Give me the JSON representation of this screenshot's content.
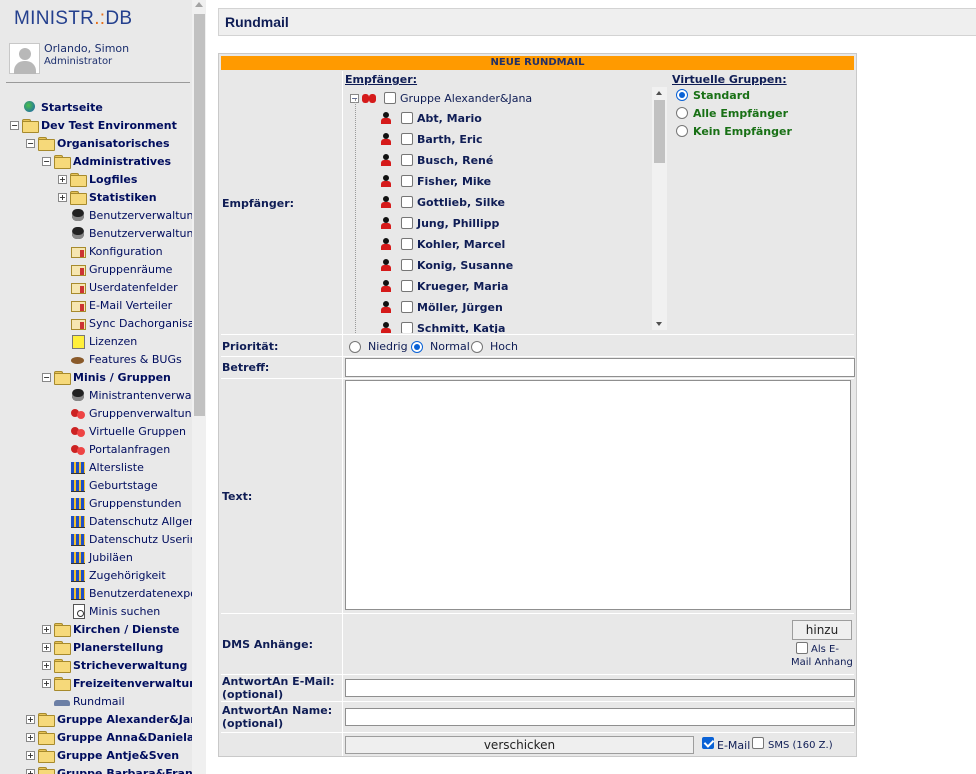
{
  "app": {
    "logo_left": "MINISTR",
    "logo_dot": ".:",
    "logo_right": "DB"
  },
  "user": {
    "name": "Orlando, Simon",
    "role": "Administrator"
  },
  "tree": [
    {
      "label": "Startseite",
      "icon": "globe-icon",
      "level": 0,
      "bold": true,
      "toggle": ""
    },
    {
      "label": "Dev Test Environment",
      "icon": "folder-icon",
      "level": 0,
      "bold": true,
      "toggle": "−"
    },
    {
      "label": "Organisatorisches",
      "icon": "folder-icon",
      "level": 1,
      "bold": true,
      "toggle": "−"
    },
    {
      "label": "Administratives",
      "icon": "folder-icon",
      "level": 2,
      "bold": true,
      "toggle": "−"
    },
    {
      "label": "Logfiles",
      "icon": "folder-icon",
      "level": 3,
      "bold": true,
      "toggle": "+"
    },
    {
      "label": "Statistiken",
      "icon": "folder-icon",
      "level": 3,
      "bold": true,
      "toggle": "+"
    },
    {
      "label": "Benutzerverwaltung",
      "icon": "agent-icon",
      "level": 3,
      "bold": false,
      "toggle": ""
    },
    {
      "label": "Benutzerverwaltung",
      "icon": "agent-icon",
      "level": 3,
      "bold": false,
      "toggle": ""
    },
    {
      "label": "Konfiguration",
      "icon": "config-icon",
      "level": 3,
      "bold": false,
      "toggle": ""
    },
    {
      "label": "Gruppenräume",
      "icon": "config-icon",
      "level": 3,
      "bold": false,
      "toggle": ""
    },
    {
      "label": "Userdatenfelder",
      "icon": "config-icon",
      "level": 3,
      "bold": false,
      "toggle": ""
    },
    {
      "label": "E-Mail Verteiler",
      "icon": "config-icon",
      "level": 3,
      "bold": false,
      "toggle": ""
    },
    {
      "label": "Sync Dachorganisati",
      "icon": "config-icon",
      "level": 3,
      "bold": false,
      "toggle": ""
    },
    {
      "label": "Lizenzen",
      "icon": "license-icon",
      "level": 3,
      "bold": false,
      "toggle": ""
    },
    {
      "label": "Features & BUGs",
      "icon": "bug-icon",
      "level": 3,
      "bold": false,
      "toggle": ""
    },
    {
      "label": "Minis / Gruppen",
      "icon": "folder-icon",
      "level": 2,
      "bold": true,
      "toggle": "−"
    },
    {
      "label": "Ministrantenverwaltu",
      "icon": "agent-icon",
      "level": 3,
      "bold": false,
      "toggle": ""
    },
    {
      "label": "Gruppenverwaltung",
      "icon": "users-icon",
      "level": 3,
      "bold": false,
      "toggle": ""
    },
    {
      "label": "Virtuelle Gruppen",
      "icon": "users-icon",
      "level": 3,
      "bold": false,
      "toggle": ""
    },
    {
      "label": "Portalanfragen",
      "icon": "users-icon",
      "level": 3,
      "bold": false,
      "toggle": ""
    },
    {
      "label": "Altersliste",
      "icon": "chart-icon",
      "level": 3,
      "bold": false,
      "toggle": ""
    },
    {
      "label": "Geburtstage",
      "icon": "chart-icon",
      "level": 3,
      "bold": false,
      "toggle": ""
    },
    {
      "label": "Gruppenstunden",
      "icon": "chart-icon",
      "level": 3,
      "bold": false,
      "toggle": ""
    },
    {
      "label": "Datenschutz Allgeme",
      "icon": "chart-icon",
      "level": 3,
      "bold": false,
      "toggle": ""
    },
    {
      "label": "Datenschutz Userinfo",
      "icon": "chart-icon",
      "level": 3,
      "bold": false,
      "toggle": ""
    },
    {
      "label": "Jubiläen",
      "icon": "chart-icon",
      "level": 3,
      "bold": false,
      "toggle": ""
    },
    {
      "label": "Zugehörigkeit",
      "icon": "chart-icon",
      "level": 3,
      "bold": false,
      "toggle": ""
    },
    {
      "label": "Benutzerdatenexport",
      "icon": "chart-icon",
      "level": 3,
      "bold": false,
      "toggle": ""
    },
    {
      "label": "Minis suchen",
      "icon": "search-doc-icon",
      "level": 3,
      "bold": false,
      "toggle": ""
    },
    {
      "label": "Kirchen / Dienste",
      "icon": "folder-icon",
      "level": 2,
      "bold": true,
      "toggle": "+"
    },
    {
      "label": "Planerstellung",
      "icon": "folder-icon",
      "level": 2,
      "bold": true,
      "toggle": "+"
    },
    {
      "label": "Stricheverwaltung",
      "icon": "folder-icon",
      "level": 2,
      "bold": true,
      "toggle": "+"
    },
    {
      "label": "Freizeitenverwaltung",
      "icon": "folder-icon",
      "level": 2,
      "bold": true,
      "toggle": "+"
    },
    {
      "label": "Rundmail",
      "icon": "car-icon",
      "level": 2,
      "bold": false,
      "toggle": ""
    },
    {
      "label": "Gruppe Alexander&Jana",
      "icon": "folder-icon",
      "level": 1,
      "bold": true,
      "toggle": "+"
    },
    {
      "label": "Gruppe Anna&Daniela",
      "icon": "folder-icon",
      "level": 1,
      "bold": true,
      "toggle": "+"
    },
    {
      "label": "Gruppe Antje&Sven",
      "icon": "folder-icon",
      "level": 1,
      "bold": true,
      "toggle": "+"
    },
    {
      "label": "Gruppe Barbara&Franzi",
      "icon": "folder-icon",
      "level": 1,
      "bold": true,
      "toggle": "+"
    }
  ],
  "page": {
    "title": "Rundmail"
  },
  "form": {
    "title": "NEUE RUNDMAIL",
    "labels": {
      "recipients": "Empfänger:",
      "priority": "Priorität:",
      "subject": "Betreff:",
      "text": "Text:",
      "dms": "DMS Anhänge:",
      "reply_email_1": "AntwortAn E-Mail:",
      "reply_email_2": "(optional)",
      "reply_name_1": "AntwortAn Name:",
      "reply_name_2": "(optional)"
    },
    "recipients_header": "Empfänger:",
    "group": {
      "label": "Gruppe Alexander&Jana",
      "toggle": "⊟"
    },
    "members": [
      "Abt, Mario",
      "Barth, Eric",
      "Busch, René",
      "Fisher, Mike",
      "Gottlieb, Silke",
      "Jung, Phillipp",
      "Kohler, Marcel",
      "Konig, Susanne",
      "Krueger, Maria",
      "Möller, Jürgen",
      "Schmitt, Katja"
    ],
    "virtual_groups_header": "Virtuelle Gruppen:",
    "virtual_groups": [
      {
        "label": "Standard",
        "selected": true
      },
      {
        "label": "Alle Empfänger",
        "selected": false
      },
      {
        "label": "Kein Empfänger",
        "selected": false
      }
    ],
    "priority_options": [
      {
        "label": "Niedrig",
        "selected": false
      },
      {
        "label": "Normal",
        "selected": true
      },
      {
        "label": "Hoch",
        "selected": false
      }
    ],
    "subject_value": "",
    "text_value": "",
    "hinzu_label": "hinzu",
    "attach_line1": "Als E-",
    "attach_line2": "Mail Anhang",
    "send_label": "verschicken",
    "email_option": "E-Mail",
    "sms_option": "SMS (160 Z.)",
    "email_checked": true,
    "sms_checked": false
  }
}
